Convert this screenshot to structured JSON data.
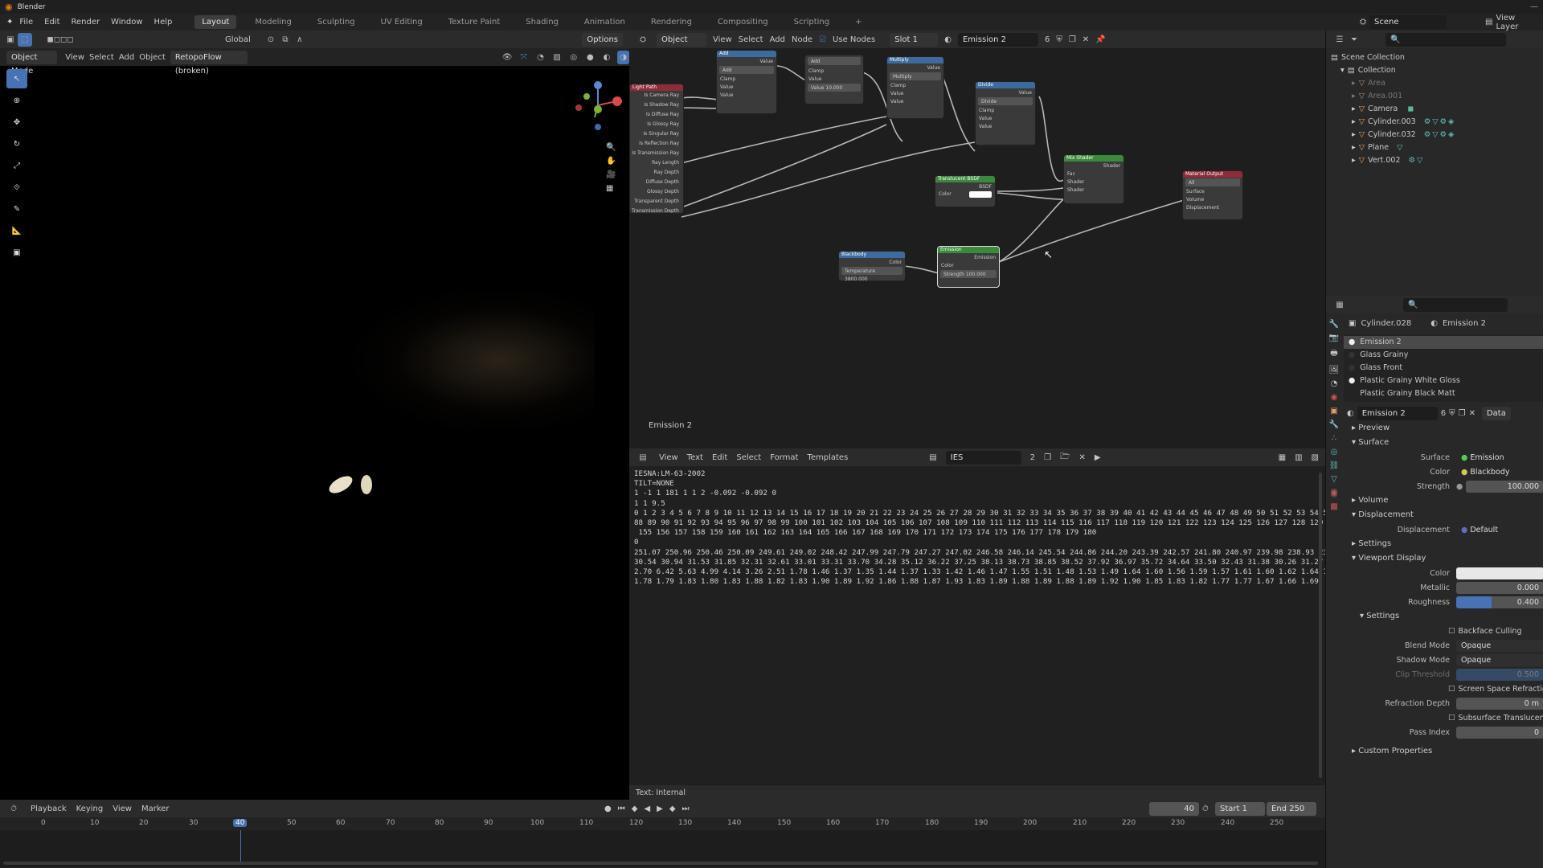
{
  "app": {
    "title": "Blender"
  },
  "menu": [
    "File",
    "Edit",
    "Render",
    "Window",
    "Help"
  ],
  "workspaces": [
    "Layout",
    "Modeling",
    "Sculpting",
    "UV Editing",
    "Texture Paint",
    "Shading",
    "Animation",
    "Rendering",
    "Compositing",
    "Scripting"
  ],
  "scene": "Scene",
  "view_layer": "View Layer",
  "viewport": {
    "transform": "Global",
    "options": "Options",
    "mode": "Object Mode",
    "menus": [
      "View",
      "Select",
      "Add",
      "Object"
    ],
    "addon": "RetopoFlow (broken)"
  },
  "node_editor": {
    "mode": "Object",
    "menus": [
      "View",
      "Select",
      "Add",
      "Node"
    ],
    "use_nodes": "Use Nodes",
    "slot": "Slot 1",
    "material": "Emission 2",
    "users": "6",
    "label": "Emission 2"
  },
  "nodes": {
    "light_path": {
      "title": "Light Path",
      "outputs": [
        "Is Camera Ray",
        "Is Shadow Ray",
        "Is Diffuse Ray",
        "Is Glossy Ray",
        "Is Singular Ray",
        "Is Reflection Ray",
        "Is Transmission Ray",
        "Ray Length",
        "Ray Depth",
        "Diffuse Depth",
        "Glossy Depth",
        "Transparent Depth",
        "Transmission Depth"
      ]
    },
    "add": {
      "title": "Add",
      "out": "Value",
      "op": "Add",
      "clamp": "Clamp",
      "in": [
        "Value",
        "Value"
      ]
    },
    "add2": {
      "op": "Add",
      "clamp": "Clamp",
      "in": "Value",
      "val": "Value   10.000"
    },
    "multiply": {
      "title": "Multiply",
      "out": "Value",
      "op": "Multiply",
      "clamp": "Clamp",
      "in": [
        "Value",
        "Value"
      ]
    },
    "divide": {
      "title": "Divide",
      "out": "Value",
      "op": "Divide",
      "clamp": "Clamp",
      "in": [
        "Value",
        "Value"
      ]
    },
    "translucent": {
      "title": "Translucent BSDF",
      "out": "BSDF",
      "in": "Color"
    },
    "mix": {
      "title": "Mix Shader",
      "out": "Shader",
      "in": [
        "Fac",
        "Shader",
        "Shader"
      ]
    },
    "output": {
      "title": "Material Output",
      "target": "All",
      "in": [
        "Surface",
        "Volume",
        "Displacement"
      ]
    },
    "blackbody": {
      "title": "Blackbody",
      "out": "Color",
      "val": "Temperature 3800.000"
    },
    "emission": {
      "title": "Emission",
      "out": "Emission",
      "in": "Color",
      "val": "Strength 100.000"
    }
  },
  "text_editor": {
    "menus": [
      "View",
      "Text",
      "Edit",
      "Select",
      "Format",
      "Templates"
    ],
    "file": "IES",
    "users": "2",
    "footer": "Text: Internal",
    "lines": [
      "IESNA:LM-63-2002",
      "",
      "TILT=NONE",
      "1 -1 1 181 1 1 2 -0.092 -0.092 0",
      "1 1 9.5",
      "0 1 2 3 4 5 6 7 8 9 10 11 12 13 14 15 16 17 18 19 20 21 22 23 24 25 26 27 28 29 30 31 32 33 34 35 36 37 38 39 40 41 42 43 44 45 46 47 48 49 50 51 52 53 54 55 56 57",
      "88 89 90 91 92 93 94 95 96 97 98 99 100 101 102 103 104 105 106 107 108 109 110 111 112 113 114 115 116 117 118 119 120 121 122 123 124 125 126 127 128 129 130 131",
      " 155 156 157 158 159 160 161 162 163 164 165 166 167 168 169 170 171 172 173 174 175 176 177 178 179 180",
      "0",
      "251.07 250.96 250.46 250.09 249.61 249.02 248.42 247.99 247.79 247.27 247.02 246.58 246.14 245.54 244.86 244.20 243.39 242.57 241.80 240.97 239.98 238.93 230.41 211",
      "30.54 30.94 31.53 31.85 32.31 32.61 33.01 33.31 33.70 34.28 35.12 36.22 37.25 38.13 38.73 38.85 38.52 37.92 36.97 35.72 34.64 33.50 32.43 31.38 30.26 31.27 31",
      "2.70 6.42 5.63 4.99 4.14 3.26 2.51 1.78 1.46 1.37 1.35 1.44 1.37 1.33 1.42 1.46 1.47 1.55 1.51 1.48 1.53 1.49 1.64 1.60 1.56 1.59 1.57 1.61 1.60 1.62 1.64 1.6",
      "1.78 1.79 1.83 1.80 1.83 1.88 1.82 1.83 1.90 1.89 1.92 1.86 1.88 1.87 1.93 1.83 1.89 1.88 1.89 1.88 1.89 1.92 1.90 1.85 1.83 1.82 1.77 1.77 1.67 1.66 1.69"
    ]
  },
  "timeline": {
    "menus": [
      "Playback",
      "Keying",
      "View",
      "Marker"
    ],
    "current": "40",
    "start_label": "Start",
    "start": "1",
    "end_label": "End",
    "end": "250",
    "ticks": [
      "0",
      "10",
      "20",
      "30",
      "40",
      "50",
      "60",
      "70",
      "80",
      "90",
      "100",
      "110",
      "120",
      "130",
      "140",
      "150",
      "160",
      "170",
      "180",
      "190",
      "200",
      "210",
      "220",
      "230",
      "240",
      "250"
    ]
  },
  "outliner": {
    "root": "Scene Collection",
    "collection": "Collection",
    "items": [
      "Area",
      "Area.001",
      "Camera",
      "Cylinder.003",
      "Cylinder.032",
      "Plane",
      "Vert.002"
    ]
  },
  "properties": {
    "object": "Cylinder.028",
    "material": "Emission 2",
    "slots": [
      "Emission 2",
      "Glass Grainy",
      "Glass Front",
      "Plastic Grainy White Gloss",
      "Plastic Grainy Black Matt"
    ],
    "mat_name": "Emission 2",
    "mat_users": "6",
    "data": "Data",
    "sections": {
      "preview": "Preview",
      "surface": "Surface",
      "volume": "Volume",
      "displacement": "Displacement",
      "settings": "Settings",
      "viewport_display": "Viewport Display",
      "settings2": "Settings",
      "custom": "Custom Properties"
    },
    "surface": {
      "label": "Surface",
      "value": "Emission"
    },
    "color": {
      "label": "Color",
      "value": "Blackbody"
    },
    "strength": {
      "label": "Strength",
      "value": "100.000"
    },
    "disp": {
      "label": "Displacement",
      "value": "Default"
    },
    "vd_color": {
      "label": "Color"
    },
    "metallic": {
      "label": "Metallic",
      "value": "0.000"
    },
    "roughness": {
      "label": "Roughness",
      "value": "0.400",
      "fraction": 0.4
    },
    "backface": "Backface Culling",
    "blend": {
      "label": "Blend Mode",
      "value": "Opaque"
    },
    "shadow": {
      "label": "Shadow Mode",
      "value": "Opaque"
    },
    "clip": {
      "label": "Clip Threshold",
      "value": "0.500"
    },
    "ssr": "Screen Space Refraction",
    "refr": {
      "label": "Refraction Depth",
      "value": "0 m"
    },
    "sst": "Subsurface Translucency",
    "pass": {
      "label": "Pass Index",
      "value": "0"
    }
  },
  "colors": {
    "accent": "#4772b3",
    "playhead": "#4772b3",
    "node_green": "#3b8a3b",
    "node_blue": "#3d6b9e",
    "node_red": "#8e2d3a"
  }
}
